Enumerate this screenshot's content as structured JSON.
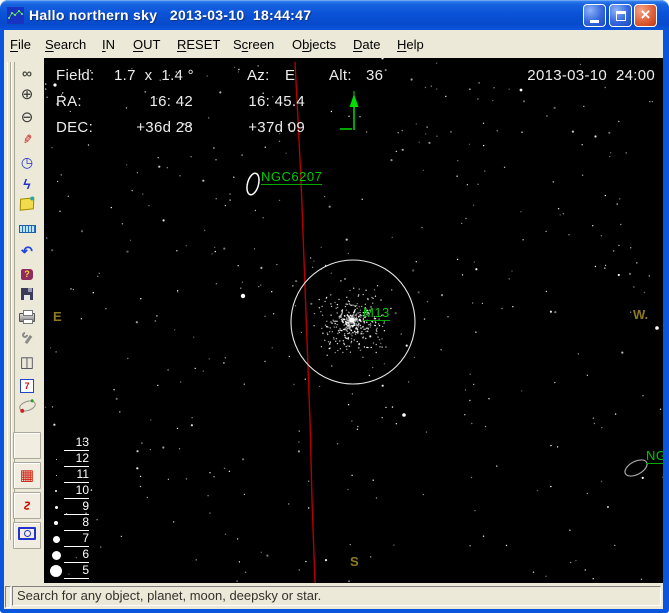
{
  "title_bar": {
    "title": "Hallo northern sky   2013-03-10  18:44:47",
    "controls": {
      "minimize": "minimize",
      "maximize": "maximize",
      "close": "close"
    }
  },
  "menu_bar": {
    "items": [
      {
        "label": "File",
        "underline": 0
      },
      {
        "label": "Search",
        "underline": 0
      },
      {
        "label": "IN",
        "underline": 0
      },
      {
        "label": "OUT",
        "underline": 0
      },
      {
        "label": "RESET",
        "underline": 0
      },
      {
        "label": "Screen",
        "underline": 1
      },
      {
        "label": "Objects",
        "underline": 1
      },
      {
        "label": "Date",
        "underline": 0
      },
      {
        "label": "Help",
        "underline": 0
      }
    ]
  },
  "toolbar": {
    "buttons": [
      "binoculars-search",
      "zoom-in",
      "zoom-out",
      "red-pencil",
      "clock",
      "walking-person",
      "yellow-note",
      "ruler",
      "undo",
      "help-book",
      "save-floppy",
      "printer",
      "wrench",
      "open-book",
      "calendar-7",
      "orbit",
      "blank",
      "red-grid",
      "constellation-lines",
      "camera"
    ]
  },
  "sky": {
    "readout": {
      "field_label": "Field:",
      "field_value": "1.7  x  1.4 °",
      "az_label": "Az:",
      "az_value": "E",
      "alt_label": "Alt:",
      "alt_value": "36",
      "datetime": "2013-03-10  24:00",
      "ra_label": "RA:",
      "ra_center": "16: 42",
      "ra_cursor": "16: 45.4",
      "dec_label": "DEC:",
      "dec_center": "+36d 28",
      "dec_cursor": "+37d 09"
    },
    "objects": {
      "ngc6207": "NGC6207",
      "m13": "M13",
      "ng_clipped": "NG"
    },
    "directions": {
      "east": "E",
      "west": "W.",
      "south": "S"
    },
    "magnitude_scale": {
      "values": [
        "13",
        "12",
        "11",
        "10",
        "9",
        "8",
        "7",
        "6",
        "5"
      ],
      "dot_sizes": [
        0,
        1,
        1,
        2,
        3,
        4,
        7,
        9,
        12
      ]
    },
    "colors": {
      "label_green": "#00C800",
      "arrow_green": "#00DD00",
      "direction_olive": "#8F7A1E",
      "line_red": "#B40000",
      "chrome_beige": "#ECE9D8",
      "titlebar_blue": "#0A53D8"
    }
  },
  "status_bar": {
    "text": "Search for any object, planet, moon, deepsky or star."
  }
}
